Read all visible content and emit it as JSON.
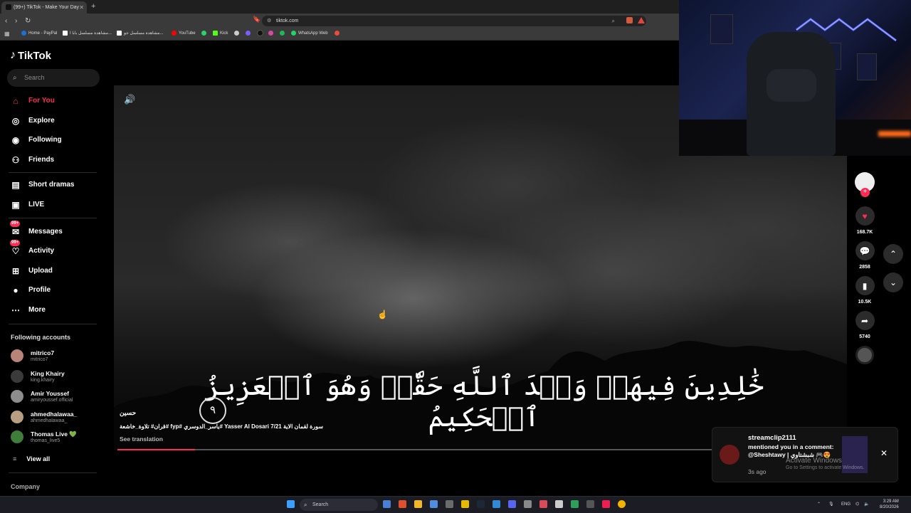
{
  "browser": {
    "tab_title": "(99+) TikTok - Make Your Day",
    "url": "tiktok.com",
    "bookmarks": [
      {
        "label": "Home - PayPal",
        "color": "#1f6fd6"
      },
      {
        "label": "مشاهدة مسلسل بابا ا...",
        "color": "#ffffff"
      },
      {
        "label": "مشاهدة مسلسل جو...",
        "color": "#ffffff"
      },
      {
        "label": "YouTube",
        "color": "#ff0000"
      },
      {
        "label": "",
        "color": "#2cd26b"
      },
      {
        "label": "Kick",
        "color": "#53fc18"
      },
      {
        "label": "",
        "color": "#cccccc"
      },
      {
        "label": "",
        "color": "#7b5cff"
      },
      {
        "label": "",
        "color": "#111111"
      },
      {
        "label": "",
        "color": "#1db954"
      },
      {
        "label": "WhatsApp Web",
        "color": "#25d366"
      },
      {
        "label": "",
        "color": "#e74c3c"
      }
    ]
  },
  "tiktok": {
    "logo": "TikTok",
    "search_placeholder": "Search",
    "nav": [
      {
        "label": "For You",
        "icon": "home-icon"
      },
      {
        "label": "Explore",
        "icon": "compass-icon"
      },
      {
        "label": "Following",
        "icon": "following-icon"
      },
      {
        "label": "Friends",
        "icon": "friends-icon"
      },
      {
        "label": "Short dramas",
        "icon": "film-icon"
      },
      {
        "label": "LIVE",
        "icon": "live-icon"
      },
      {
        "label": "Messages",
        "icon": "message-icon",
        "badge": "99+"
      },
      {
        "label": "Activity",
        "icon": "activity-icon",
        "badge": "99+"
      },
      {
        "label": "Upload",
        "icon": "upload-icon"
      },
      {
        "label": "Profile",
        "icon": "profile-icon"
      },
      {
        "label": "More",
        "icon": "more-icon"
      }
    ],
    "following_title": "Following accounts",
    "accounts": [
      {
        "name": "mitrico7",
        "handle": "mitrico7"
      },
      {
        "name": "King Khairy",
        "handle": "king.khairy"
      },
      {
        "name": "Amir Youssef",
        "handle": "amiryoussef.official"
      },
      {
        "name": "ahmedhalawaa_",
        "handle": "ahmedhalawaa_"
      },
      {
        "name": "Thomas Live 💚",
        "handle": "thomas_live5"
      }
    ],
    "view_all": "View all",
    "company": "Company"
  },
  "video": {
    "arabic_overlay": "خَٰلِدِينَ فِيهَاۖ وَعۡدَ ٱللَّهِ حَقّٗاۚ وَهُوَ ٱلۡعَزِيزُ ٱلۡحَكِيمُ",
    "ayah_number": "٩",
    "author": "حسين",
    "caption": "قران# تلاوة_خاشعة# fyp# ياسر_الدوسري# Yasser Al Dosari سورة لقمان الاية 7/21",
    "see_translation": "See translation",
    "progress": 0.13
  },
  "actions": {
    "likes": "168.7K",
    "comments": "2858",
    "saves": "10.5K",
    "shares": "5740"
  },
  "notification": {
    "user": "streamclip2111",
    "message": "mentioned you in a comment: @Sheshtawy | شبشتاوي 🎮😍",
    "time": "3s ago"
  },
  "watermark": {
    "title": "Activate Windows",
    "subtitle": "Go to Settings to activate Windows."
  },
  "taskbar": {
    "search": "Search",
    "lang": "ENG",
    "time": "3:29 AM",
    "date": "8/20/2026"
  }
}
